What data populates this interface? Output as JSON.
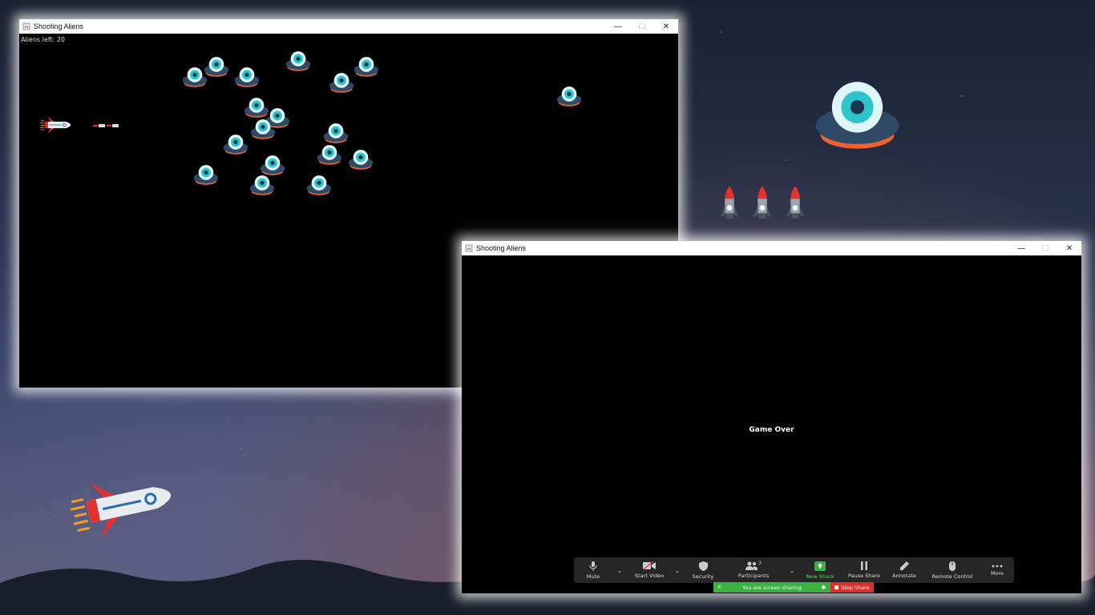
{
  "window1": {
    "title": "Shooting Aliens",
    "status_text": "Aliens left: 20",
    "controls": {
      "minimize": "—",
      "maximize": "☐",
      "close": "✕"
    }
  },
  "window2": {
    "title": "Shooting Aliens",
    "message": "Game Over",
    "controls": {
      "minimize": "—",
      "maximize": "☐",
      "close": "✕"
    }
  },
  "zoom_toolbar": {
    "mute": "Mute",
    "start_video": "Start Video",
    "security": "Security",
    "participants": "Participants",
    "participants_count": "3",
    "new_share": "New Share",
    "pause_share": "Pause Share",
    "annotate": "Annotate",
    "remote_control": "Remote Control",
    "more": "More",
    "sharing_status": "You are screen sharing",
    "stop_share": "Stop Share"
  },
  "colors": {
    "alien_body": "#2e4a66",
    "alien_dome": "#2ec4c9",
    "alien_rim": "#f06030",
    "ship_body": "#e8ecef",
    "ship_red": "#e53030",
    "share_green": "#3cb043",
    "stop_red": "#d9302e"
  }
}
